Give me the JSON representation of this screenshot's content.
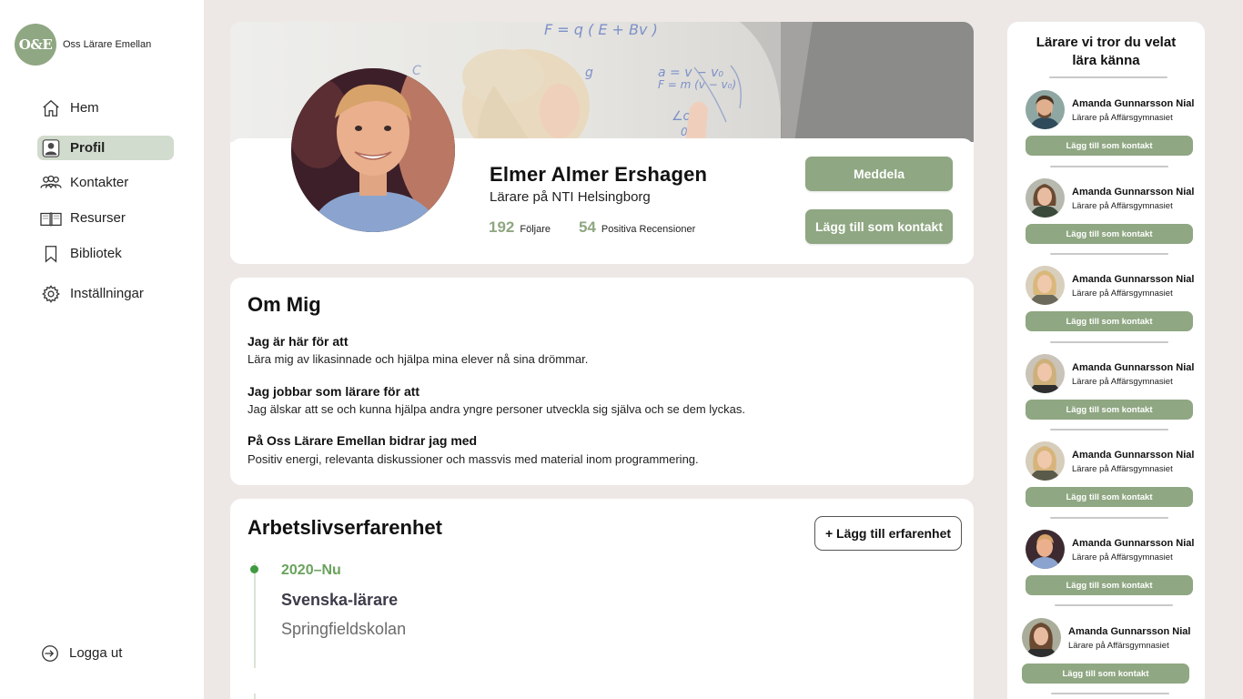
{
  "app": {
    "logo_mark": "O&E",
    "logo_text": "Oss Lärare Emellan"
  },
  "nav": {
    "items": [
      {
        "label": "Hem",
        "icon": "home-icon"
      },
      {
        "label": "Profil",
        "icon": "user-icon"
      },
      {
        "label": "Kontakter",
        "icon": "contacts-icon"
      },
      {
        "label": "Resurser",
        "icon": "book-icon"
      },
      {
        "label": "Bibliotek",
        "icon": "bookmark-icon"
      },
      {
        "label": "Inställningar",
        "icon": "gear-icon"
      }
    ],
    "logout": "Logga ut",
    "active": "Profil"
  },
  "profile": {
    "name": "Elmer Almer Ershagen",
    "role": "Lärare på NTI Helsingborg",
    "followers_count": "192",
    "followers_label": "Följare",
    "reviews_count": "54",
    "reviews_label": "Positiva Recensioner",
    "message_button": "Meddela",
    "add_contact_button": "Lägg till som kontakt"
  },
  "about": {
    "title": "Om Mig",
    "q1": "Jag är här för att",
    "a1": "Lära mig av likasinnade och hjälpa mina elever nå sina drömmar.",
    "q2": "Jag jobbar som lärare för att",
    "a2": "Jag älskar att se och kunna hjälpa andra yngre personer utveckla sig själva och se dem lyckas.",
    "q3": "På Oss Lärare Emellan bidrar jag med",
    "a3": "Positiv energi, relevanta diskussioner och massvis med material inom programmering."
  },
  "experience": {
    "title": "Arbetslivserfarenhet",
    "add_button": "+ Lägg till erfarenhet",
    "items": [
      {
        "period": "2020–Nu",
        "title": "Svenska-lärare",
        "org": "Springfieldskolan"
      }
    ]
  },
  "suggestions": {
    "title_line1": "Lärare vi tror du  velat",
    "title_line2": "lära känna",
    "people": [
      {
        "name": "Amanda Gunnarsson Nial",
        "role": "Lärare på Affärsgymnasiet",
        "button": "Lägg till som kontakt"
      },
      {
        "name": "Amanda Gunnarsson Nial",
        "role": "Lärare på Affärsgymnasiet",
        "button": "Lägg till som kontakt"
      },
      {
        "name": "Amanda Gunnarsson Nial",
        "role": "Lärare på Affärsgymnasiet",
        "button": "Lägg till som kontakt"
      },
      {
        "name": "Amanda Gunnarsson Nial",
        "role": "Lärare på Affärsgymnasiet",
        "button": "Lägg till som kontakt"
      },
      {
        "name": "Amanda Gunnarsson Nial",
        "role": "Lärare på Affärsgymnasiet",
        "button": "Lägg till som kontakt"
      },
      {
        "name": "Amanda Gunnarsson Nial",
        "role": "Lärare på Affärsgymnasiet",
        "button": "Lägg till som kontakt"
      },
      {
        "name": "Amanda Gunnarsson Nial",
        "role": "Lärare på Affärsgymnasiet",
        "button": "Lägg till som kontakt"
      }
    ]
  },
  "colors": {
    "accent": "#8fa782",
    "active_nav": "#d2dcce",
    "background": "#ede8e6",
    "timeline_dot": "#3f9a3f",
    "period_text": "#6aa35d"
  }
}
